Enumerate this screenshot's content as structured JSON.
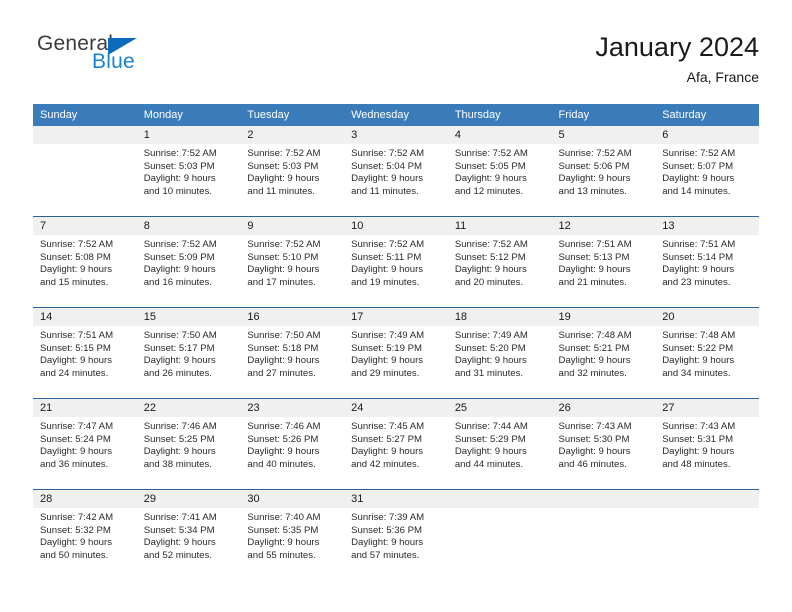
{
  "brand": {
    "name_part1": "General",
    "name_part2": "Blue",
    "color_dark": "#3c3c3c",
    "color_blue": "#1884d6",
    "triangle_color": "#0b6bbd"
  },
  "header": {
    "title": "January 2024",
    "subtitle": "Afa, France"
  },
  "theme": {
    "header_bg": "#3a7cba",
    "header_text": "#ffffff",
    "daynum_bg": "#f0f0f0",
    "week_divider": "#2b6298"
  },
  "weekday_headers": [
    "Sunday",
    "Monday",
    "Tuesday",
    "Wednesday",
    "Thursday",
    "Friday",
    "Saturday"
  ],
  "weeks": [
    [
      {
        "day": "",
        "sunrise": "",
        "sunset": "",
        "daylight_line1": "",
        "daylight_line2": "",
        "empty": true
      },
      {
        "day": "1",
        "sunrise": "Sunrise: 7:52 AM",
        "sunset": "Sunset: 5:03 PM",
        "daylight_line1": "Daylight: 9 hours",
        "daylight_line2": "and 10 minutes."
      },
      {
        "day": "2",
        "sunrise": "Sunrise: 7:52 AM",
        "sunset": "Sunset: 5:03 PM",
        "daylight_line1": "Daylight: 9 hours",
        "daylight_line2": "and 11 minutes."
      },
      {
        "day": "3",
        "sunrise": "Sunrise: 7:52 AM",
        "sunset": "Sunset: 5:04 PM",
        "daylight_line1": "Daylight: 9 hours",
        "daylight_line2": "and 11 minutes."
      },
      {
        "day": "4",
        "sunrise": "Sunrise: 7:52 AM",
        "sunset": "Sunset: 5:05 PM",
        "daylight_line1": "Daylight: 9 hours",
        "daylight_line2": "and 12 minutes."
      },
      {
        "day": "5",
        "sunrise": "Sunrise: 7:52 AM",
        "sunset": "Sunset: 5:06 PM",
        "daylight_line1": "Daylight: 9 hours",
        "daylight_line2": "and 13 minutes."
      },
      {
        "day": "6",
        "sunrise": "Sunrise: 7:52 AM",
        "sunset": "Sunset: 5:07 PM",
        "daylight_line1": "Daylight: 9 hours",
        "daylight_line2": "and 14 minutes."
      }
    ],
    [
      {
        "day": "7",
        "sunrise": "Sunrise: 7:52 AM",
        "sunset": "Sunset: 5:08 PM",
        "daylight_line1": "Daylight: 9 hours",
        "daylight_line2": "and 15 minutes."
      },
      {
        "day": "8",
        "sunrise": "Sunrise: 7:52 AM",
        "sunset": "Sunset: 5:09 PM",
        "daylight_line1": "Daylight: 9 hours",
        "daylight_line2": "and 16 minutes."
      },
      {
        "day": "9",
        "sunrise": "Sunrise: 7:52 AM",
        "sunset": "Sunset: 5:10 PM",
        "daylight_line1": "Daylight: 9 hours",
        "daylight_line2": "and 17 minutes."
      },
      {
        "day": "10",
        "sunrise": "Sunrise: 7:52 AM",
        "sunset": "Sunset: 5:11 PM",
        "daylight_line1": "Daylight: 9 hours",
        "daylight_line2": "and 19 minutes."
      },
      {
        "day": "11",
        "sunrise": "Sunrise: 7:52 AM",
        "sunset": "Sunset: 5:12 PM",
        "daylight_line1": "Daylight: 9 hours",
        "daylight_line2": "and 20 minutes."
      },
      {
        "day": "12",
        "sunrise": "Sunrise: 7:51 AM",
        "sunset": "Sunset: 5:13 PM",
        "daylight_line1": "Daylight: 9 hours",
        "daylight_line2": "and 21 minutes."
      },
      {
        "day": "13",
        "sunrise": "Sunrise: 7:51 AM",
        "sunset": "Sunset: 5:14 PM",
        "daylight_line1": "Daylight: 9 hours",
        "daylight_line2": "and 23 minutes."
      }
    ],
    [
      {
        "day": "14",
        "sunrise": "Sunrise: 7:51 AM",
        "sunset": "Sunset: 5:15 PM",
        "daylight_line1": "Daylight: 9 hours",
        "daylight_line2": "and 24 minutes."
      },
      {
        "day": "15",
        "sunrise": "Sunrise: 7:50 AM",
        "sunset": "Sunset: 5:17 PM",
        "daylight_line1": "Daylight: 9 hours",
        "daylight_line2": "and 26 minutes."
      },
      {
        "day": "16",
        "sunrise": "Sunrise: 7:50 AM",
        "sunset": "Sunset: 5:18 PM",
        "daylight_line1": "Daylight: 9 hours",
        "daylight_line2": "and 27 minutes."
      },
      {
        "day": "17",
        "sunrise": "Sunrise: 7:49 AM",
        "sunset": "Sunset: 5:19 PM",
        "daylight_line1": "Daylight: 9 hours",
        "daylight_line2": "and 29 minutes."
      },
      {
        "day": "18",
        "sunrise": "Sunrise: 7:49 AM",
        "sunset": "Sunset: 5:20 PM",
        "daylight_line1": "Daylight: 9 hours",
        "daylight_line2": "and 31 minutes."
      },
      {
        "day": "19",
        "sunrise": "Sunrise: 7:48 AM",
        "sunset": "Sunset: 5:21 PM",
        "daylight_line1": "Daylight: 9 hours",
        "daylight_line2": "and 32 minutes."
      },
      {
        "day": "20",
        "sunrise": "Sunrise: 7:48 AM",
        "sunset": "Sunset: 5:22 PM",
        "daylight_line1": "Daylight: 9 hours",
        "daylight_line2": "and 34 minutes."
      }
    ],
    [
      {
        "day": "21",
        "sunrise": "Sunrise: 7:47 AM",
        "sunset": "Sunset: 5:24 PM",
        "daylight_line1": "Daylight: 9 hours",
        "daylight_line2": "and 36 minutes."
      },
      {
        "day": "22",
        "sunrise": "Sunrise: 7:46 AM",
        "sunset": "Sunset: 5:25 PM",
        "daylight_line1": "Daylight: 9 hours",
        "daylight_line2": "and 38 minutes."
      },
      {
        "day": "23",
        "sunrise": "Sunrise: 7:46 AM",
        "sunset": "Sunset: 5:26 PM",
        "daylight_line1": "Daylight: 9 hours",
        "daylight_line2": "and 40 minutes."
      },
      {
        "day": "24",
        "sunrise": "Sunrise: 7:45 AM",
        "sunset": "Sunset: 5:27 PM",
        "daylight_line1": "Daylight: 9 hours",
        "daylight_line2": "and 42 minutes."
      },
      {
        "day": "25",
        "sunrise": "Sunrise: 7:44 AM",
        "sunset": "Sunset: 5:29 PM",
        "daylight_line1": "Daylight: 9 hours",
        "daylight_line2": "and 44 minutes."
      },
      {
        "day": "26",
        "sunrise": "Sunrise: 7:43 AM",
        "sunset": "Sunset: 5:30 PM",
        "daylight_line1": "Daylight: 9 hours",
        "daylight_line2": "and 46 minutes."
      },
      {
        "day": "27",
        "sunrise": "Sunrise: 7:43 AM",
        "sunset": "Sunset: 5:31 PM",
        "daylight_line1": "Daylight: 9 hours",
        "daylight_line2": "and 48 minutes."
      }
    ],
    [
      {
        "day": "28",
        "sunrise": "Sunrise: 7:42 AM",
        "sunset": "Sunset: 5:32 PM",
        "daylight_line1": "Daylight: 9 hours",
        "daylight_line2": "and 50 minutes."
      },
      {
        "day": "29",
        "sunrise": "Sunrise: 7:41 AM",
        "sunset": "Sunset: 5:34 PM",
        "daylight_line1": "Daylight: 9 hours",
        "daylight_line2": "and 52 minutes."
      },
      {
        "day": "30",
        "sunrise": "Sunrise: 7:40 AM",
        "sunset": "Sunset: 5:35 PM",
        "daylight_line1": "Daylight: 9 hours",
        "daylight_line2": "and 55 minutes."
      },
      {
        "day": "31",
        "sunrise": "Sunrise: 7:39 AM",
        "sunset": "Sunset: 5:36 PM",
        "daylight_line1": "Daylight: 9 hours",
        "daylight_line2": "and 57 minutes."
      },
      {
        "day": "",
        "sunrise": "",
        "sunset": "",
        "daylight_line1": "",
        "daylight_line2": "",
        "empty": true
      },
      {
        "day": "",
        "sunrise": "",
        "sunset": "",
        "daylight_line1": "",
        "daylight_line2": "",
        "empty": true
      },
      {
        "day": "",
        "sunrise": "",
        "sunset": "",
        "daylight_line1": "",
        "daylight_line2": "",
        "empty": true
      }
    ]
  ]
}
